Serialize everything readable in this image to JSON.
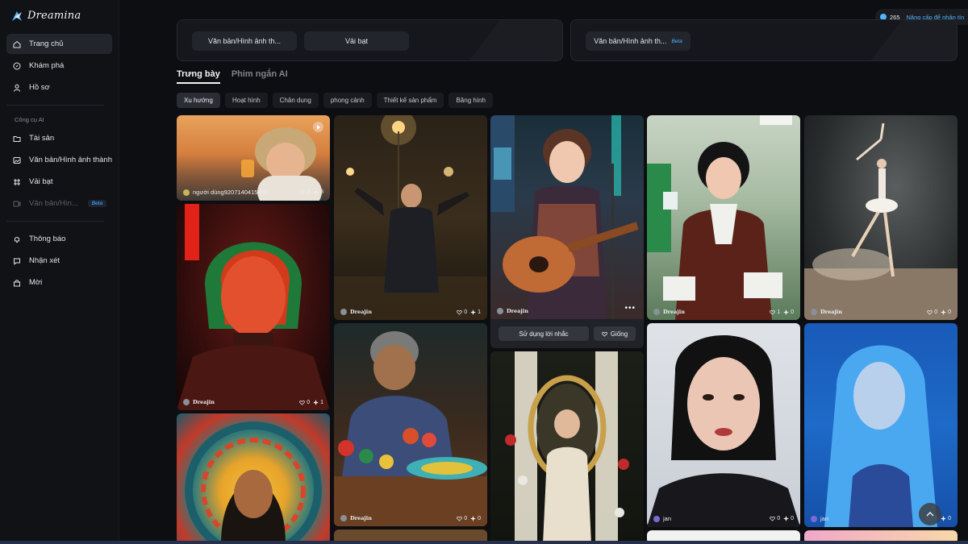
{
  "app": {
    "name": "Dreamina"
  },
  "topbar": {
    "credits": "265",
    "upgrade": "Nâng cấp để nhận tín"
  },
  "sidebar": {
    "items": [
      {
        "label": "Trang chủ",
        "icon": "home-icon",
        "active": true
      },
      {
        "label": "Khám phá",
        "icon": "compass-icon"
      },
      {
        "label": "Hồ sơ",
        "icon": "user-icon"
      }
    ],
    "section_label": "Công cụ AI",
    "tools": [
      {
        "label": "Tài sản",
        "icon": "folder-icon"
      },
      {
        "label": "Văn bản/Hình ảnh thành h",
        "icon": "image-icon"
      },
      {
        "label": "Vải bạt",
        "icon": "canvas-icon"
      },
      {
        "label": "Văn bản/Hìn...",
        "icon": "video-icon",
        "beta": "Beta",
        "disabled": true
      }
    ],
    "bottom": [
      {
        "label": "Thông báo",
        "icon": "bell-icon"
      },
      {
        "label": "Nhận xét",
        "icon": "feedback-icon"
      },
      {
        "label": "Mời",
        "icon": "invite-icon"
      }
    ]
  },
  "feature_cards": {
    "left": {
      "btn1": "Văn bản/Hình ảnh th...",
      "btn2": "Vải bạt"
    },
    "right": {
      "btn1": "Văn bản/Hình ảnh th...",
      "beta": "Beta"
    }
  },
  "tabs": [
    {
      "label": "Trưng bày",
      "active": true
    },
    {
      "label": "Phim ngắn AI"
    }
  ],
  "filters": [
    "Xu hướng",
    "Hoạt hình",
    "Chân dung",
    "phong cảnh",
    "Thiết kế sản phẩm",
    "Băng hình"
  ],
  "gallery": {
    "c1": {
      "author": "người dùng9207140415459",
      "likes": "5",
      "remix": "3"
    },
    "c2": {
      "author": "Dreajin",
      "likes": "0",
      "remix": "1"
    },
    "c3": {
      "author": "Dreajin",
      "likes": "0",
      "remix": "1"
    },
    "c4": {
      "author": "Dreajin",
      "likes": "0",
      "remix": "0"
    },
    "c5": {
      "author": "Dreajin",
      "likes": "0",
      "remix": "0"
    },
    "c6": {
      "author": "Dreajin",
      "likes": "0",
      "remix": "1"
    },
    "c7": {
      "author": "Dreajin",
      "likes": "1",
      "remix": "0"
    },
    "c8": {
      "author": "Dreajin",
      "likes": "0",
      "remix": "0"
    },
    "c9": {
      "author": "jan",
      "likes": "0",
      "remix": "0"
    },
    "c10": {
      "author": "jan",
      "likes": "0",
      "remix": "0"
    }
  },
  "hover_panel": {
    "use_prompt": "Sử dụng lời nhắc",
    "like": "Giống"
  }
}
